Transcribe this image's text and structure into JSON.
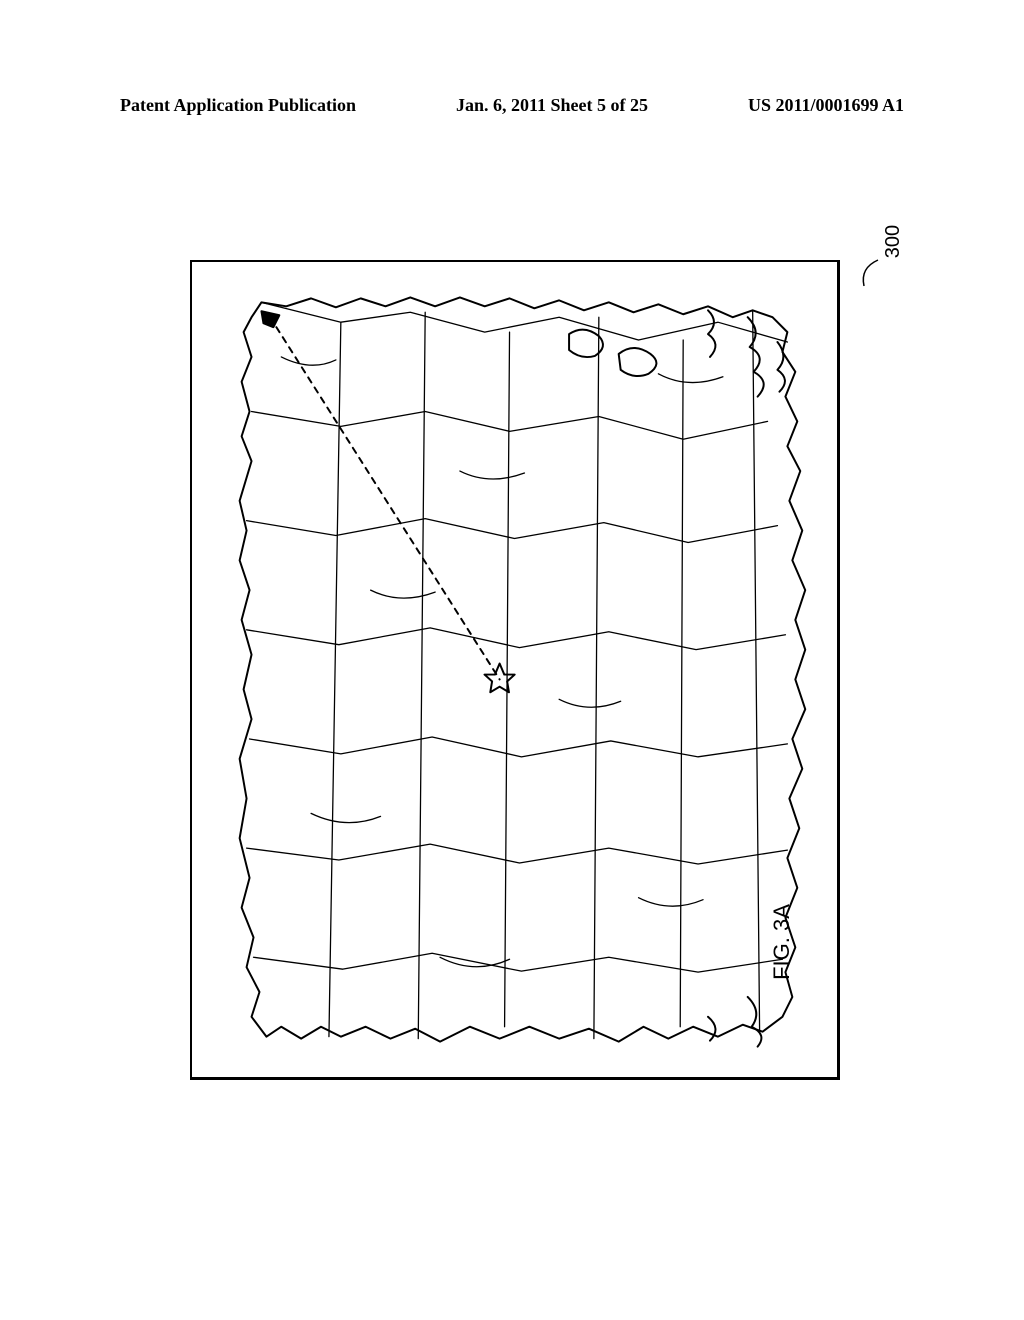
{
  "header": {
    "left": "Patent Application Publication",
    "center": "Jan. 6, 2011  Sheet 5 of 25",
    "right": "US 2011/0001699 A1"
  },
  "figure": {
    "reference_number": "300",
    "label": "FIG. 3A"
  }
}
